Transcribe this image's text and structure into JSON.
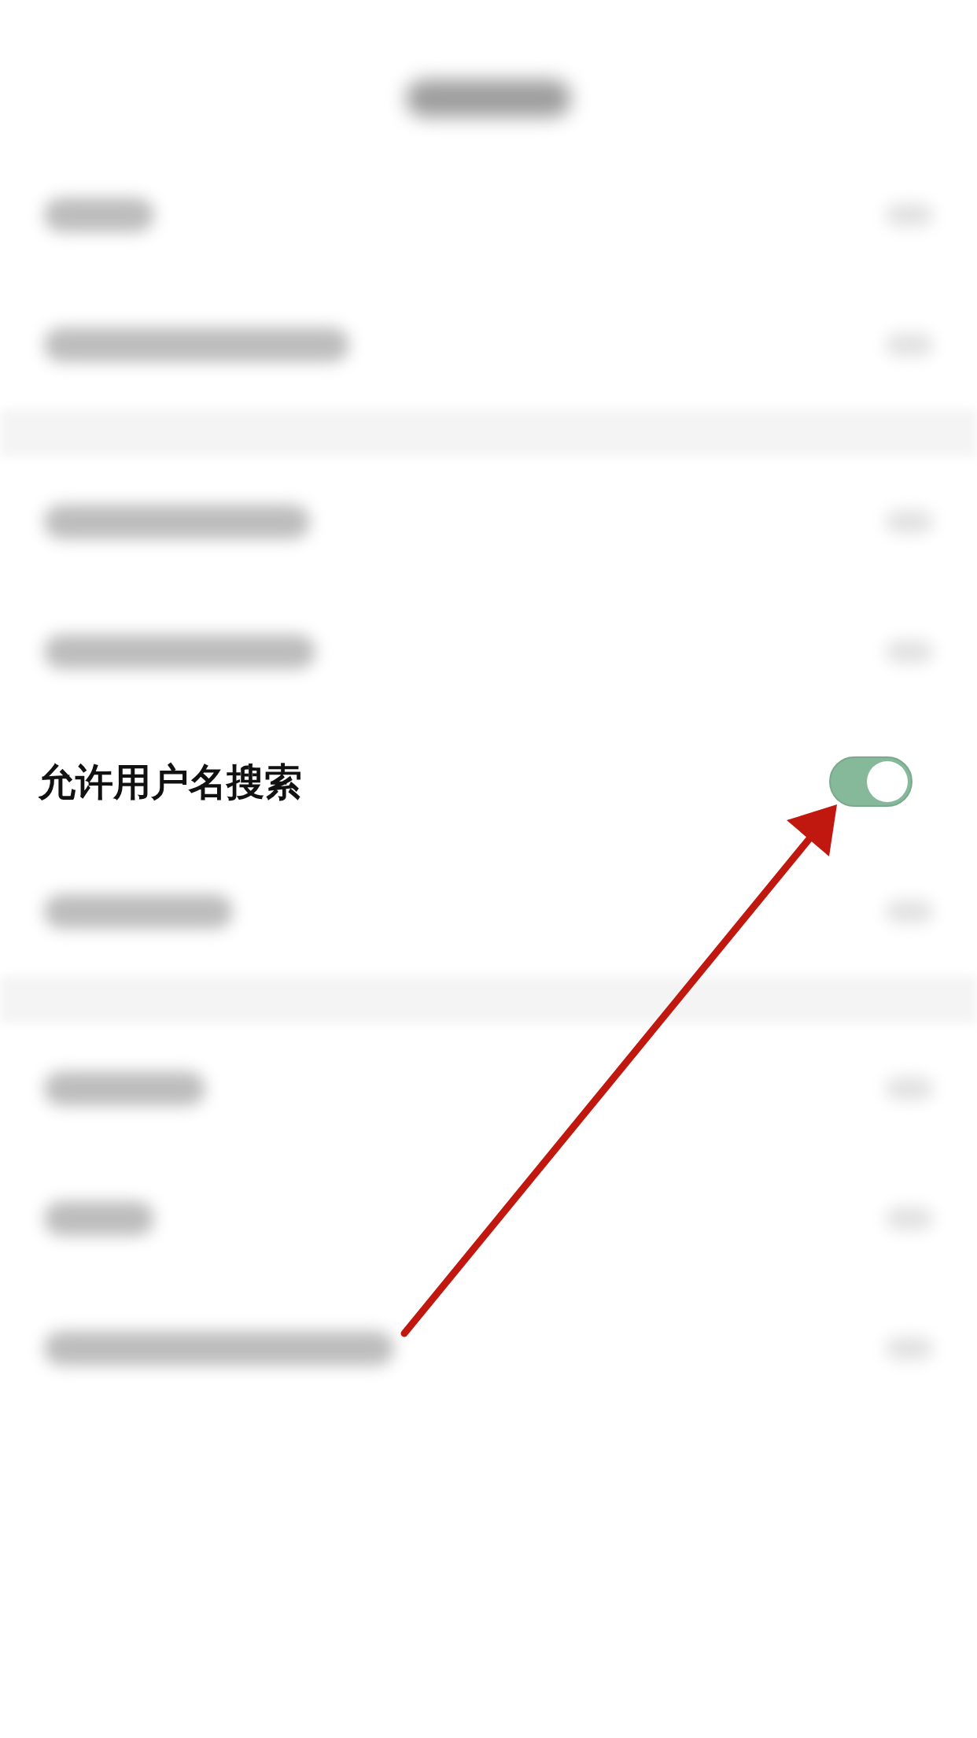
{
  "setting": {
    "label": "允许用户名搜索",
    "on": true
  }
}
